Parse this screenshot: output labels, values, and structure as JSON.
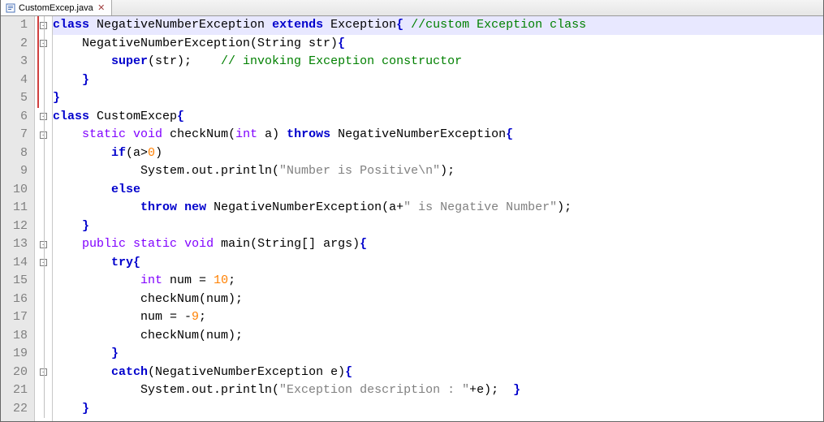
{
  "tab": {
    "label": "CustomExcep.java",
    "icon": "java-file-icon",
    "close": "✕"
  },
  "lineCount": 22,
  "highlightLine": 1,
  "foldRedStart": 1,
  "foldRedEnd": 5,
  "foldBoxes": {
    "1": "-",
    "2": "-",
    "6": "-",
    "7": "-",
    "13": "-",
    "14": "-",
    "20": "-"
  },
  "lines": [
    [
      [
        "kw",
        "class"
      ],
      [
        "pln",
        " NegativeNumberException "
      ],
      [
        "kw",
        "extends"
      ],
      [
        "pln",
        " Exception"
      ],
      [
        "kw",
        "{"
      ],
      [
        "pln",
        " "
      ],
      [
        "cm",
        "//custom Exception class"
      ]
    ],
    [
      [
        "pln",
        "    NegativeNumberException(String str)"
      ],
      [
        "kw",
        "{"
      ]
    ],
    [
      [
        "pln",
        "        "
      ],
      [
        "kw",
        "super"
      ],
      [
        "pln",
        "(str);    "
      ],
      [
        "cm",
        "// invoking Exception constructor"
      ]
    ],
    [
      [
        "pln",
        "    "
      ],
      [
        "kw",
        "}"
      ]
    ],
    [
      [
        "kw",
        "}"
      ]
    ],
    [
      [
        "kw",
        "class"
      ],
      [
        "pln",
        " CustomExcep"
      ],
      [
        "kw",
        "{"
      ]
    ],
    [
      [
        "pln",
        "    "
      ],
      [
        "type",
        "static"
      ],
      [
        "pln",
        " "
      ],
      [
        "type",
        "void"
      ],
      [
        "pln",
        " checkNum("
      ],
      [
        "type",
        "int"
      ],
      [
        "pln",
        " a) "
      ],
      [
        "kw",
        "throws"
      ],
      [
        "pln",
        " NegativeNumberException"
      ],
      [
        "kw",
        "{"
      ]
    ],
    [
      [
        "pln",
        "        "
      ],
      [
        "kw",
        "if"
      ],
      [
        "pln",
        "(a>"
      ],
      [
        "num",
        "0"
      ],
      [
        "pln",
        ")"
      ]
    ],
    [
      [
        "pln",
        "            System.out.println("
      ],
      [
        "str",
        "\"Number is Positive\\n\""
      ],
      [
        "pln",
        ");"
      ]
    ],
    [
      [
        "pln",
        "        "
      ],
      [
        "kw",
        "else"
      ]
    ],
    [
      [
        "pln",
        "            "
      ],
      [
        "kw",
        "throw"
      ],
      [
        "pln",
        " "
      ],
      [
        "kw",
        "new"
      ],
      [
        "pln",
        " NegativeNumberException(a+"
      ],
      [
        "str",
        "\" is Negative Number\""
      ],
      [
        "pln",
        ");"
      ]
    ],
    [
      [
        "pln",
        "    "
      ],
      [
        "kw",
        "}"
      ]
    ],
    [
      [
        "pln",
        "    "
      ],
      [
        "type",
        "public"
      ],
      [
        "pln",
        " "
      ],
      [
        "type",
        "static"
      ],
      [
        "pln",
        " "
      ],
      [
        "type",
        "void"
      ],
      [
        "pln",
        " main(String[] args)"
      ],
      [
        "kw",
        "{"
      ]
    ],
    [
      [
        "pln",
        "        "
      ],
      [
        "kw",
        "try{"
      ]
    ],
    [
      [
        "pln",
        "            "
      ],
      [
        "type",
        "int"
      ],
      [
        "pln",
        " num = "
      ],
      [
        "num",
        "10"
      ],
      [
        "pln",
        ";"
      ]
    ],
    [
      [
        "pln",
        "            checkNum(num);"
      ]
    ],
    [
      [
        "pln",
        "            num = -"
      ],
      [
        "num",
        "9"
      ],
      [
        "pln",
        ";"
      ]
    ],
    [
      [
        "pln",
        "            checkNum(num);"
      ]
    ],
    [
      [
        "pln",
        "        "
      ],
      [
        "kw",
        "}"
      ]
    ],
    [
      [
        "pln",
        "        "
      ],
      [
        "kw",
        "catch"
      ],
      [
        "pln",
        "(NegativeNumberException e)"
      ],
      [
        "kw",
        "{"
      ]
    ],
    [
      [
        "pln",
        "            System.out.println("
      ],
      [
        "str",
        "\"Exception description : \""
      ],
      [
        "pln",
        "+e);  "
      ],
      [
        "kw",
        "}"
      ]
    ],
    [
      [
        "pln",
        "    "
      ],
      [
        "kw",
        "}"
      ]
    ]
  ]
}
